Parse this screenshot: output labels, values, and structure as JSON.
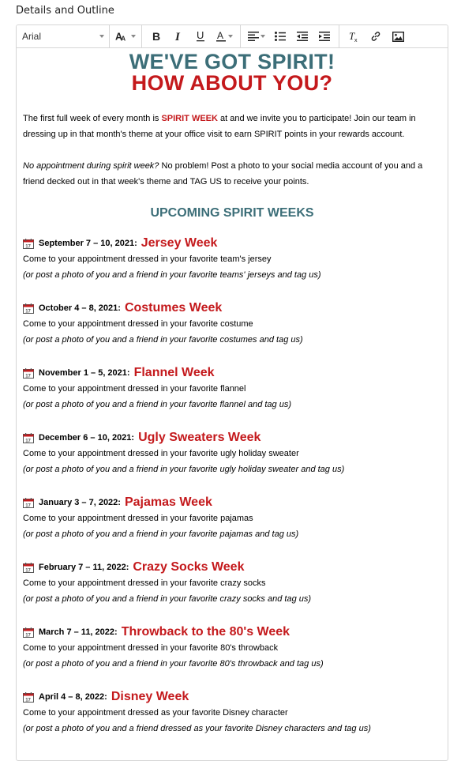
{
  "section_label": "Details and Outline",
  "toolbar": {
    "font": "Arial"
  },
  "content": {
    "heading1": "WE'VE GOT SPIRIT!",
    "heading2": "HOW ABOUT YOU?",
    "intro_prefix": "The first full week of every month is ",
    "intro_highlight": "SPIRIT WEEK",
    "intro_suffix": " at and we invite you to participate! Join our team in dressing up in that month's theme at your office visit to earn SPIRIT points in your rewards account.",
    "para2_italic": "No appointment during spirit week?",
    "para2_rest": " No problem! Post a photo to your social media account of you and a friend decked out in that week's theme and TAG US to receive your points.",
    "upcoming_title": "UPCOMING SPIRIT WEEKS",
    "events": [
      {
        "date": "September 7 – 10, 2021:",
        "name": "Jersey Week",
        "line1": "Come to your appointment dressed in your favorite team's jersey",
        "line2": "(or post a photo of you and a friend in your favorite teams' jerseys and tag us)"
      },
      {
        "date": "October 4 – 8, 2021:",
        "name": "Costumes Week",
        "line1": "Come to your appointment dressed in your favorite costume",
        "line2": "(or post a photo of you and a friend in your favorite costumes and tag us)"
      },
      {
        "date": "November 1 – 5, 2021:",
        "name": "Flannel Week",
        "line1": "Come to your appointment dressed in your favorite flannel",
        "line2": "(or post a photo of you and a friend in your favorite flannel and tag us)"
      },
      {
        "date": "December 6 – 10, 2021:",
        "name": "Ugly Sweaters Week",
        "line1": "Come to your appointment dressed in your favorite ugly holiday sweater",
        "line2": "(or post a photo of you and a friend in your favorite ugly holiday sweater and tag us)"
      },
      {
        "date": "January 3 – 7, 2022:",
        "name": "Pajamas Week",
        "line1": "Come to your appointment dressed in your favorite pajamas",
        "line2": "(or post a photo of you and a friend in your favorite pajamas and tag us)"
      },
      {
        "date": "February 7 – 11, 2022:",
        "name": "Crazy Socks Week",
        "line1": "Come to your appointment dressed in your favorite crazy socks",
        "line2": "(or post a photo of you and a friend in your favorite crazy socks and tag us)"
      },
      {
        "date": "March 7 – 11, 2022:",
        "name": "Throwback to the 80's Week",
        "line1": "Come to your appointment dressed in your favorite 80's throwback",
        "line2": "(or post a photo of you and a friend in your favorite 80's throwback and tag us)"
      },
      {
        "date": "April 4 – 8, 2022:",
        "name": "Disney Week",
        "line1": "Come to your appointment dressed as your favorite Disney character",
        "line2": "(or post a photo of you and a friend dressed as your favorite Disney characters and tag us)"
      }
    ]
  },
  "colors": {
    "teal": "#3c6e78",
    "red": "#c4191c",
    "border": "#d6d6d6"
  }
}
